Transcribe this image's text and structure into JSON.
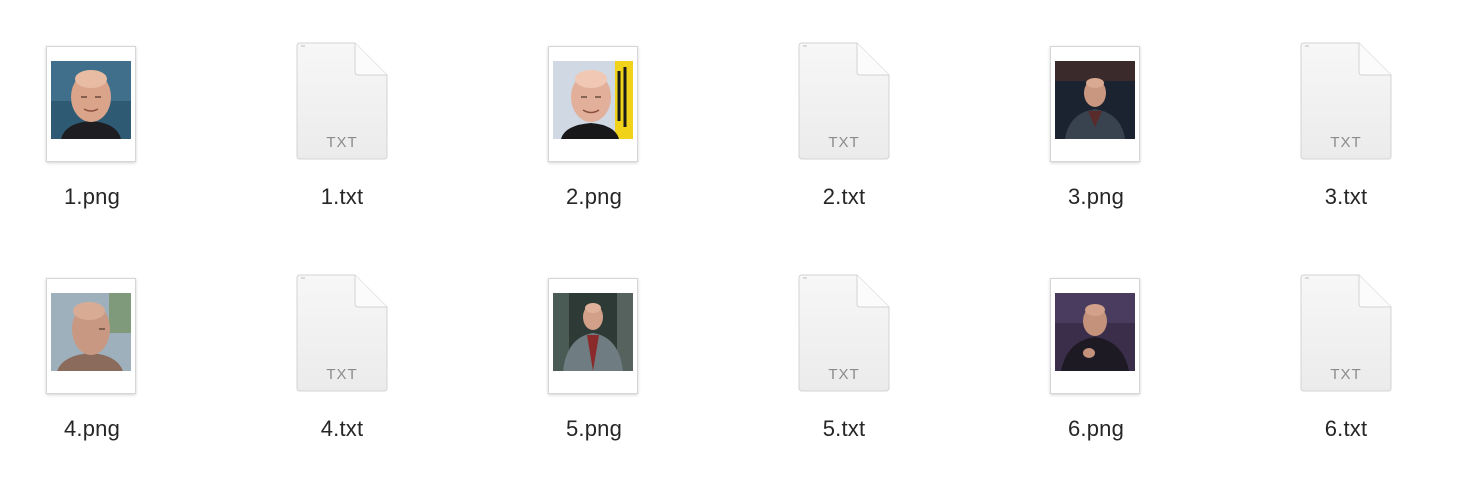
{
  "files": [
    {
      "name": "1.png",
      "kind": "image",
      "icon": "portrait-thumbnail-icon"
    },
    {
      "name": "1.txt",
      "kind": "text",
      "icon": "text-document-icon",
      "badge": "TXT"
    },
    {
      "name": "2.png",
      "kind": "image",
      "icon": "portrait-thumbnail-icon"
    },
    {
      "name": "2.txt",
      "kind": "text",
      "icon": "text-document-icon",
      "badge": "TXT"
    },
    {
      "name": "3.png",
      "kind": "image",
      "icon": "portrait-thumbnail-icon"
    },
    {
      "name": "3.txt",
      "kind": "text",
      "icon": "text-document-icon",
      "badge": "TXT"
    },
    {
      "name": "4.png",
      "kind": "image",
      "icon": "portrait-thumbnail-icon"
    },
    {
      "name": "4.txt",
      "kind": "text",
      "icon": "text-document-icon",
      "badge": "TXT"
    },
    {
      "name": "5.png",
      "kind": "image",
      "icon": "portrait-thumbnail-icon"
    },
    {
      "name": "5.txt",
      "kind": "text",
      "icon": "text-document-icon",
      "badge": "TXT"
    },
    {
      "name": "6.png",
      "kind": "image",
      "icon": "portrait-thumbnail-icon"
    },
    {
      "name": "6.txt",
      "kind": "text",
      "icon": "text-document-icon",
      "badge": "TXT"
    }
  ],
  "colors": {
    "label_text": "#262626",
    "doc_badge": "#8b8b8b",
    "doc_fill": "#f2f2f2",
    "background": "#ffffff"
  }
}
